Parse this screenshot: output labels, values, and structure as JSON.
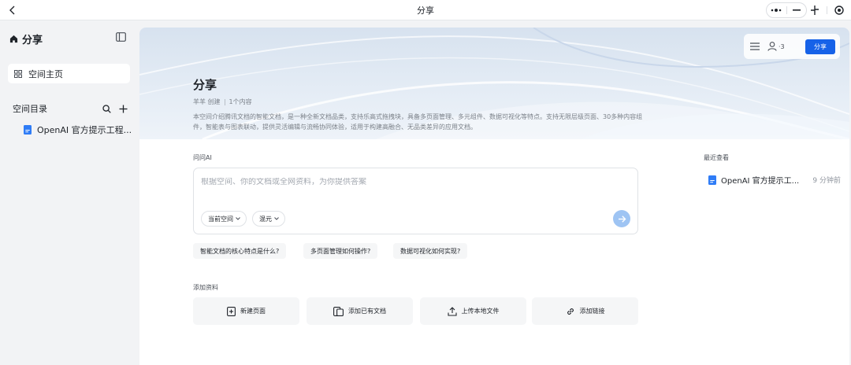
{
  "topbar": {
    "title": "分享"
  },
  "sidebar": {
    "title": "分享",
    "home_label": "空间主页",
    "directory_label": "空间目录",
    "documents": [
      {
        "label": "OpenAI 官方提示工程..."
      }
    ]
  },
  "banner": {
    "title": "分享",
    "author": "羊羊 创建",
    "content_count": "1个内容",
    "description": "本空间介绍腾讯文档的智能文档，是一种全新文档品类，支持乐高式拖拽块，具备多页面管理、多元组件、数据可视化等特点。支持无限层级页面、30多种内容组件，智能表与图表联动，提供灵活编辑与流畅协同体验，适用于构建高融合、无品类差异的应用文档。",
    "member_count": "3",
    "share_label": "分享"
  },
  "ask": {
    "section_label": "问问AI",
    "placeholder": "根据空间、你的文档或全网资料，为你提供答案",
    "scope_label": "当前空间",
    "model_label": "混元",
    "suggestions": [
      "智能文档的核心特点是什么?",
      "多页面管理如何操作?",
      "数据可视化如何实现?"
    ]
  },
  "add": {
    "section_label": "添加资料",
    "actions": [
      {
        "label": "新建页面",
        "icon": "new-page-icon"
      },
      {
        "label": "添加已有文档",
        "icon": "add-document-icon"
      },
      {
        "label": "上传本地文件",
        "icon": "upload-icon"
      },
      {
        "label": "添加链接",
        "icon": "link-icon"
      }
    ]
  },
  "recent": {
    "label": "最近查看",
    "items": [
      {
        "name": "OpenAI 官方提示工...",
        "time": "9 分钟前"
      }
    ]
  },
  "colors": {
    "accent": "#1662e8",
    "doc_icon": "#2f7cf6",
    "send_button": "#9ec4f3"
  }
}
